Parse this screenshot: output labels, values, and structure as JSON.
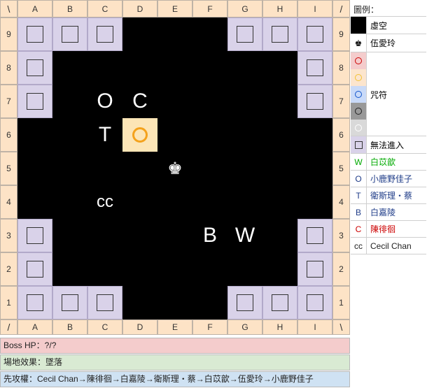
{
  "board": {
    "columns": [
      "A",
      "B",
      "C",
      "D",
      "E",
      "F",
      "G",
      "H",
      "I"
    ],
    "rows": [
      "9",
      "8",
      "7",
      "6",
      "5",
      "4",
      "3",
      "2",
      "1"
    ],
    "corner_symbols": {
      "top_left": "\\",
      "top_right": "/",
      "bottom_left": "/",
      "bottom_right": "\\"
    },
    "blocked_cells": [
      "A9",
      "B9",
      "C9",
      "G9",
      "H9",
      "I9",
      "A8",
      "I8",
      "A7",
      "I7",
      "A3",
      "I3",
      "A2",
      "I2",
      "A1",
      "B1",
      "C1",
      "G1",
      "H1",
      "I1"
    ],
    "target_cell": "D6",
    "tokens": [
      {
        "text": "O",
        "cell": "C7",
        "size": 30
      },
      {
        "text": "C",
        "cell": "D7",
        "size": 30
      },
      {
        "text": "T",
        "cell": "C6",
        "size": 30
      },
      {
        "text": "♚",
        "cell": "E5",
        "size": 24
      },
      {
        "text": "cc",
        "cell": "C4",
        "size": 24
      },
      {
        "text": "B",
        "cell": "F3",
        "size": 30
      },
      {
        "text": "W",
        "cell": "G3",
        "size": 30
      }
    ]
  },
  "legend": {
    "title": "圖例：",
    "void_label": "虛空",
    "boss_label": "伍愛玲",
    "boss_icon": "♚",
    "curse_label": "咒符",
    "curse_colors": [
      {
        "border": "#cc0000",
        "bg": "#f4cccc"
      },
      {
        "border": "#f1c232",
        "bg": "#fce5cd"
      },
      {
        "border": "#1155cc",
        "bg": "#c9daf8"
      },
      {
        "border": "#222222",
        "bg": "#999999"
      },
      {
        "border": "#ffffff",
        "bg": "#d9d9d9"
      }
    ],
    "blocked_label": "無法進入",
    "players": [
      {
        "symbol": "W",
        "name": "白苡歆",
        "color": "#00aa00"
      },
      {
        "symbol": "O",
        "name": "小鹿野佳子",
        "color": "#1f3c88"
      },
      {
        "symbol": "T",
        "name": "衛斯理・蔡",
        "color": "#1f3c88"
      },
      {
        "symbol": "B",
        "name": "白嘉陵",
        "color": "#1f3c88"
      },
      {
        "symbol": "C",
        "name": "陳徘徊",
        "color": "#cc0000"
      },
      {
        "symbol": "cc",
        "name": "Cecil Chan",
        "color": "#222222"
      }
    ]
  },
  "info": {
    "boss_hp": "Boss HP：?/?",
    "field_effect": "場地效果：墜落",
    "turn_order": "先攻權：Cecil Chan→陳徘徊→白嘉陵→衛斯理・蔡→白苡歆→伍愛玲→小鹿野佳子"
  }
}
